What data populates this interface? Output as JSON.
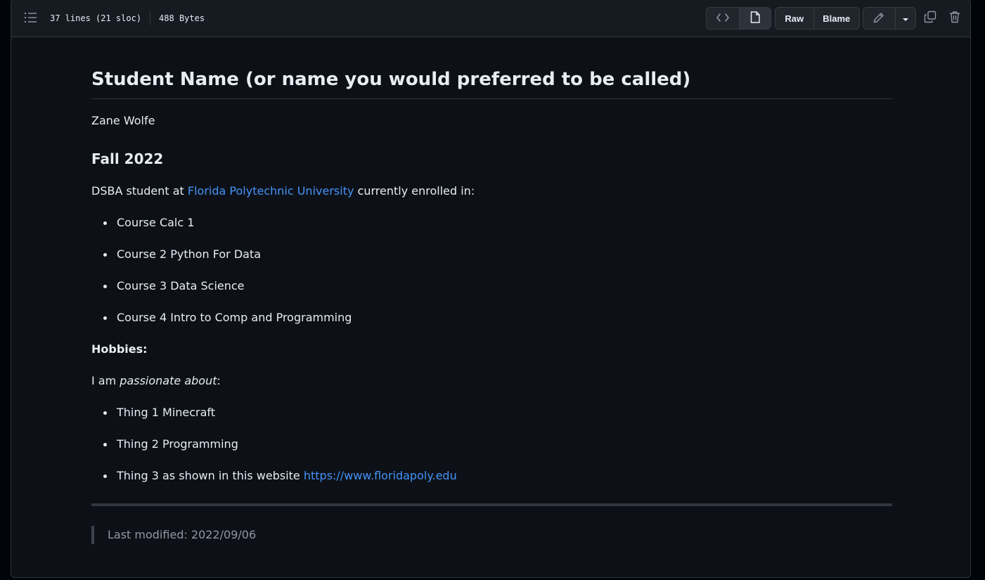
{
  "header": {
    "lines_info": "37 lines (21 sloc)",
    "size_info": "488 Bytes",
    "raw_label": "Raw",
    "blame_label": "Blame"
  },
  "content": {
    "heading": "Student Name (or name you would preferred to be called)",
    "student_name": "Zane Wolfe",
    "term_heading": "Fall 2022",
    "intro_prefix": "DSBA student at",
    "university_link": "Florida Polytechnic University",
    "intro_suffix": "currently enrolled in:",
    "courses": [
      "Course Calc 1",
      "Course 2 Python For Data",
      "Course 3 Data Science",
      "Course 4 Intro to Comp and Programming"
    ],
    "hobbies_label": "Hobbies:",
    "passion_prefix": "I am",
    "passion_em": "passionate about",
    "passion_suffix": ":",
    "things": [
      "Thing 1 Minecraft",
      "Thing 2 Programming"
    ],
    "thing3_prefix": "Thing 3 as shown in this website",
    "thing3_link": "https://www.floridapoly.edu",
    "last_modified": "Last modified: 2022/09/06"
  },
  "colors": {
    "background": "#0d1117",
    "text": "#e6edf3",
    "link": "#4493f8",
    "muted": "#9198a1",
    "border": "#30363d"
  },
  "icons": [
    "list-unordered-icon",
    "code-icon",
    "file-icon",
    "pencil-icon",
    "triangle-down-icon",
    "copy-icon",
    "trash-icon"
  ]
}
